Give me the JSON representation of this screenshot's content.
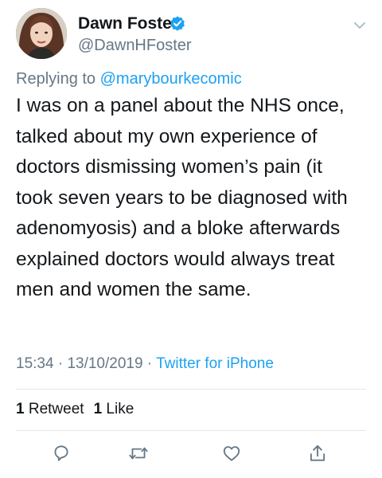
{
  "author": {
    "name": "Dawn Foster",
    "handle": "@DawnHFoster",
    "verified": true
  },
  "reply": {
    "prefix": "Replying to ",
    "mention": "@marybourkecomic"
  },
  "tweet": {
    "lines": [
      "I was on a panel about the NHS once,",
      "talked about my own experience of",
      "doctors dismissing women’s pain (it",
      "took seven years to be diagnosed with",
      "adenomyosis) and a bloke afterwards",
      "explained doctors would always treat",
      "men and women the same."
    ]
  },
  "meta": {
    "time": "15:34",
    "separator": " · ",
    "date": "13/10/2019",
    "source": "Twitter for iPhone"
  },
  "stats": {
    "retweets_count": "1",
    "retweets_label": "Retweet",
    "likes_count": "1",
    "likes_label": "Like"
  },
  "actions": [
    "reply-icon",
    "retweet-icon",
    "like-icon",
    "share-icon"
  ],
  "colors": {
    "accent": "#1da1f2",
    "secondary_text": "#657786",
    "primary_text": "#14171a",
    "divider": "#e1e8ed",
    "icon": "#657786"
  }
}
